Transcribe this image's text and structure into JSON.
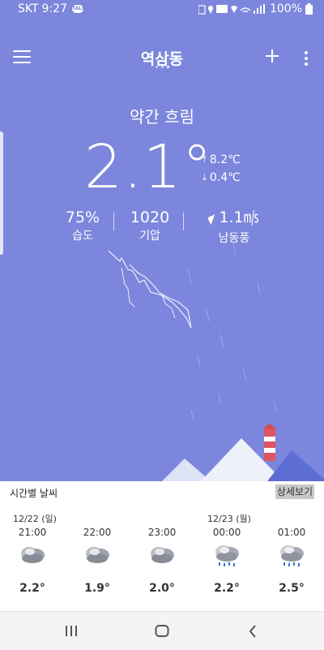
{
  "status": {
    "carrier": "SKT",
    "time": "9:27",
    "talk_badge": "TALK",
    "battery": "100%"
  },
  "header": {
    "location": "역삼동",
    "page_dots": 3,
    "active_dot": 2
  },
  "current": {
    "condition": "약간 흐림",
    "temp": "2.1°",
    "high": "8.2℃",
    "low": "0.4℃",
    "humidity": {
      "value": "75%",
      "label": "습도"
    },
    "pressure": {
      "value": "1020",
      "label": "기압"
    },
    "wind": {
      "value": "1.1㎧",
      "label": "남동풍"
    }
  },
  "hourly": {
    "title": "시간별 날씨",
    "detail_label": "상세보기",
    "date1": "12/22 (일)",
    "date2": "12/23 (월)",
    "items": [
      {
        "time": "21:00",
        "icon": "cloudy-icon",
        "temp": "2.2°"
      },
      {
        "time": "22:00",
        "icon": "cloudy-icon",
        "temp": "1.9°"
      },
      {
        "time": "23:00",
        "icon": "cloudy-icon",
        "temp": "2.0°"
      },
      {
        "time": "00:00",
        "icon": "rain-cloud-icon",
        "temp": "2.2°"
      },
      {
        "time": "01:00",
        "icon": "rain-cloud-icon",
        "temp": "2.5°"
      }
    ]
  },
  "colors": {
    "sky": "#7b86dc",
    "mountain": "#e8ebf8",
    "lighthouse_red": "#e05561"
  }
}
